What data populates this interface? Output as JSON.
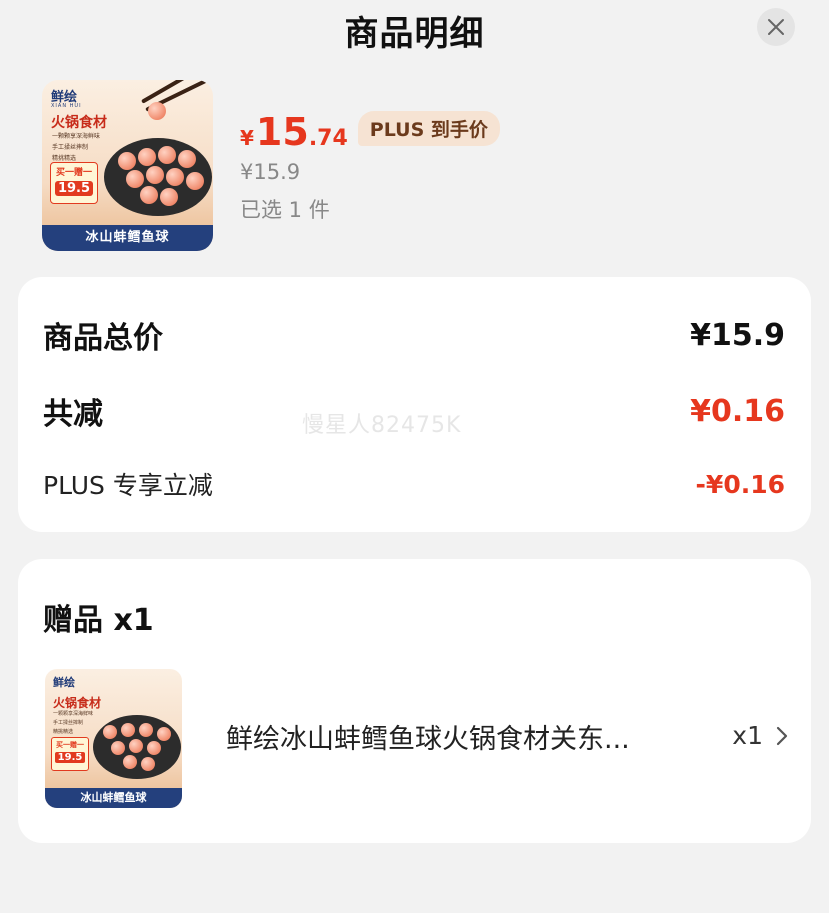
{
  "header": {
    "title": "商品明细",
    "close_icon": "close-icon"
  },
  "product": {
    "image_brand": "鲜绘",
    "image_brand_sub": "XIAN HUI",
    "image_category": "火锅食材",
    "image_features": [
      "一颗颗享深海鲜味",
      "手工揉丝摔制",
      "精挑精选"
    ],
    "image_promo_line": "买一赠一",
    "image_promo_price": "19.5",
    "image_bottom_label": "冰山蚌鳕鱼球",
    "currency_symbol": "¥",
    "price_integer": "15",
    "price_decimal": ".74",
    "plus_tag": "PLUS 到手价",
    "original_price": "¥15.9",
    "selected_count": "已选 1 件"
  },
  "summary": {
    "total_label": "商品总价",
    "total_value": "¥15.9",
    "discount_label": "共减",
    "discount_value": "¥0.16",
    "plus_label": "PLUS 专享立减",
    "plus_value": "-¥0.16",
    "accent_color": "#e6371e"
  },
  "watermark": "慢星人82475K",
  "gift": {
    "title": "赠品 x1",
    "item_name": "鲜绘冰山蚌鳕鱼球火锅食材关东...",
    "item_qty": "x1",
    "chevron_icon": "chevron-right-icon"
  }
}
